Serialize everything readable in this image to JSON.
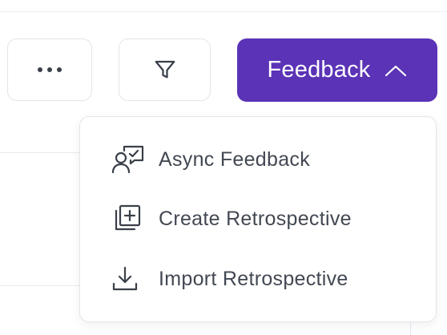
{
  "toolbar": {
    "more_icon": "more-horizontal-icon",
    "filter_icon": "filter-icon",
    "feedback_label": "Feedback",
    "feedback_chevron_icon": "chevron-up-icon",
    "accent_color": "#5b33b6"
  },
  "menu": {
    "items": [
      {
        "label": "Async Feedback",
        "icon": "async-feedback-icon"
      },
      {
        "label": "Create Retrospective",
        "icon": "add-copy-icon"
      },
      {
        "label": "Import Retrospective",
        "icon": "download-icon"
      }
    ]
  }
}
